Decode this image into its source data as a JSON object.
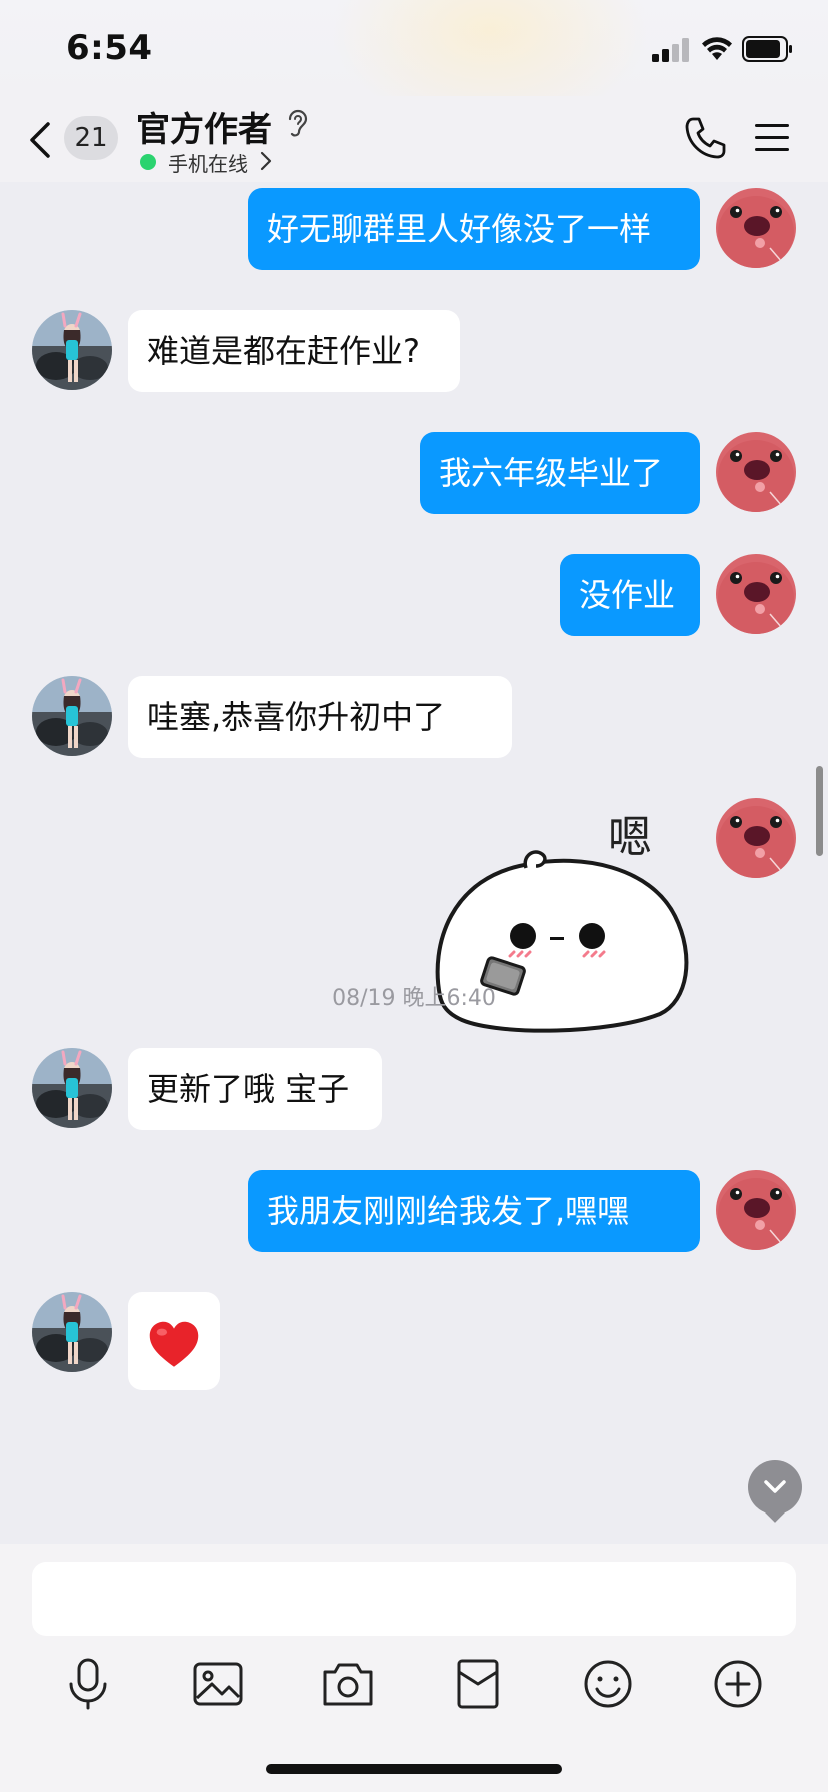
{
  "status_bar": {
    "time": "6:54"
  },
  "header": {
    "unread_count": "21",
    "title": "官方作者",
    "presence": "手机在线"
  },
  "messages": [
    {
      "dir": "out",
      "text": "好无聊群里人好像没了一样"
    },
    {
      "dir": "in",
      "text": "难道是都在赶作业?"
    },
    {
      "dir": "out",
      "text": "我六年级毕业了"
    },
    {
      "dir": "out",
      "text": "没作业"
    },
    {
      "dir": "in",
      "text": "哇塞,恭喜你升初中了"
    },
    {
      "dir": "out",
      "sticker": "嗯",
      "sticker_name": "mochi-phone-sticker"
    },
    {
      "timestamp": "08/19 晚上6:40"
    },
    {
      "dir": "in",
      "text": "更新了哦 宝子"
    },
    {
      "dir": "out",
      "text": "我朋友刚刚给我发了,嘿嘿"
    },
    {
      "dir": "in",
      "emoji": "red-heart"
    }
  ],
  "input": {
    "placeholder": ""
  },
  "toolbar": [
    "microphone-icon",
    "image-icon",
    "camera-icon",
    "red-packet-icon",
    "emoji-icon",
    "plus-icon"
  ],
  "colors": {
    "accent": "#0A99FF",
    "background": "#EDEDF2",
    "online": "#2BD36F"
  }
}
